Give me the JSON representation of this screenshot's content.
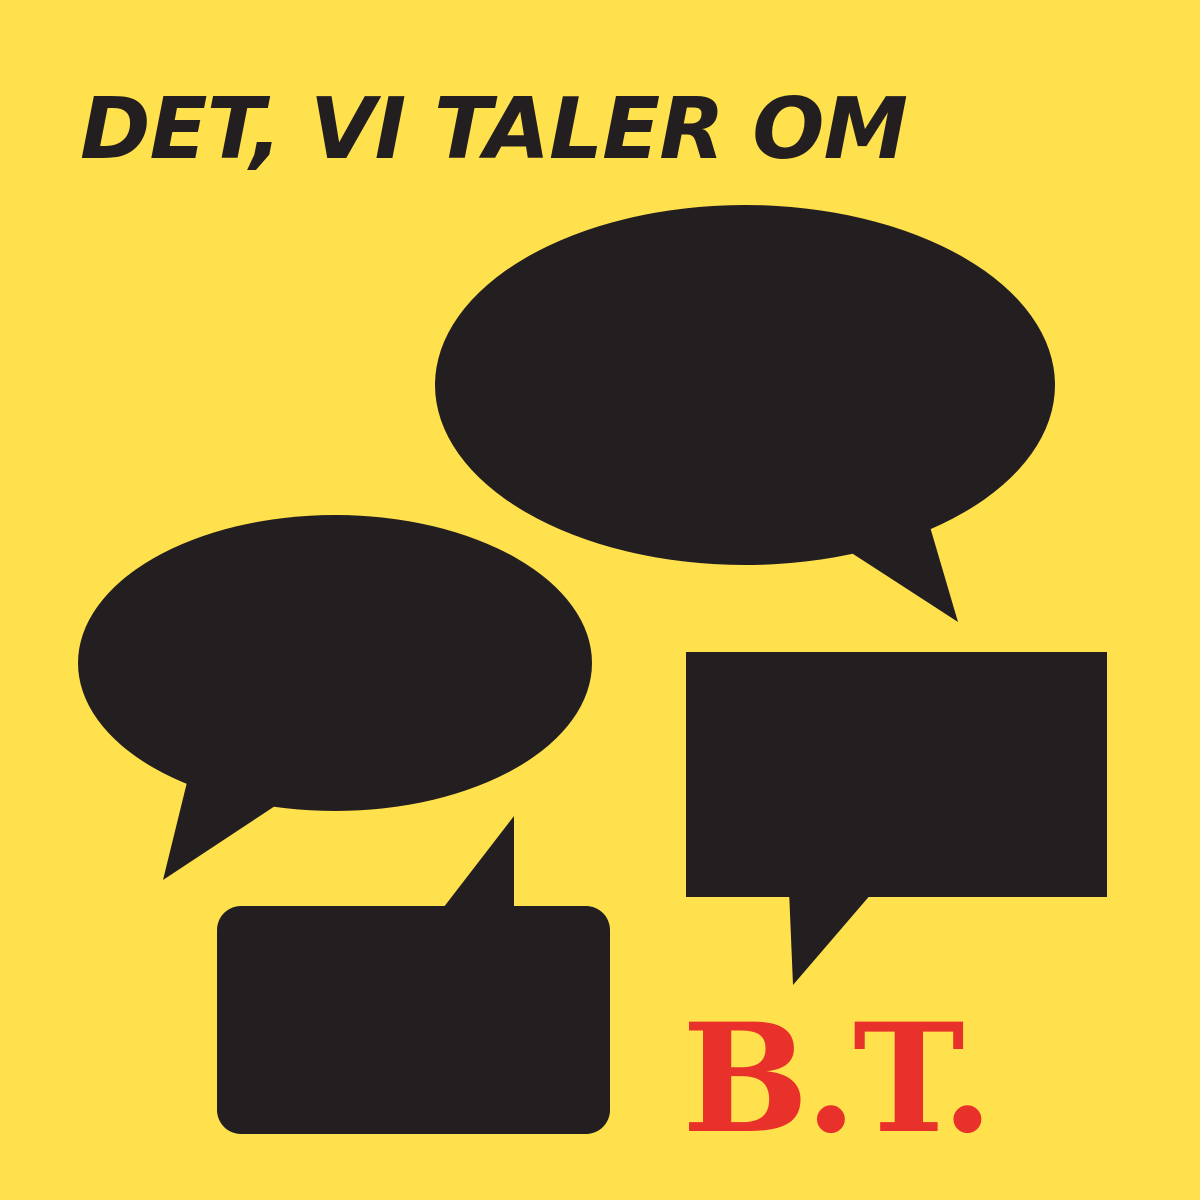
{
  "title": "DET, VI TALER OM",
  "logo_text": "B.T.",
  "colors": {
    "background": "#FFE14D",
    "bubble": "#231F20",
    "title": "#231F20",
    "logo": "#E8312B"
  },
  "bubbles": [
    {
      "name": "large-oval-speech-bubble-icon"
    },
    {
      "name": "small-oval-speech-bubble-icon"
    },
    {
      "name": "right-rectangle-speech-bubble-icon"
    },
    {
      "name": "bottom-rectangle-speech-bubble-icon"
    }
  ]
}
